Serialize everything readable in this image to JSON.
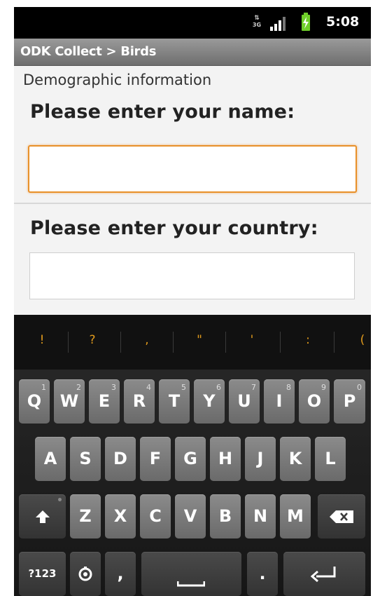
{
  "status_bar": {
    "network": "3G",
    "time": "5:08"
  },
  "app": {
    "title": "ODK Collect > Birds"
  },
  "form": {
    "group_label": "Demographic information",
    "questions": [
      {
        "label": "Please enter your name:",
        "value": ""
      },
      {
        "label": "Please enter your country:",
        "value": ""
      }
    ]
  },
  "keyboard": {
    "suggestions": [
      "!",
      "?",
      ",",
      "\"",
      "'",
      ":",
      "("
    ],
    "row1": [
      {
        "label": "Q",
        "sub": "1"
      },
      {
        "label": "W",
        "sub": "2"
      },
      {
        "label": "E",
        "sub": "3"
      },
      {
        "label": "R",
        "sub": "4"
      },
      {
        "label": "T",
        "sub": "5"
      },
      {
        "label": "Y",
        "sub": "6"
      },
      {
        "label": "U",
        "sub": "7"
      },
      {
        "label": "I",
        "sub": "8"
      },
      {
        "label": "O",
        "sub": "9"
      },
      {
        "label": "P",
        "sub": "0"
      }
    ],
    "row2": [
      "A",
      "S",
      "D",
      "F",
      "G",
      "H",
      "J",
      "K",
      "L"
    ],
    "row3": [
      "Z",
      "X",
      "C",
      "V",
      "B",
      "N",
      "M"
    ],
    "sym_label": "?123",
    "comma_label": ",",
    "period_label": ".",
    "icons": {
      "shift": "shift-arrow-icon",
      "backspace": "backspace-icon",
      "settings": "settings-icon",
      "space": "space-bar-icon",
      "enter": "enter-return-icon",
      "battery": "battery-charging-icon",
      "signal": "signal-strength-icon"
    }
  }
}
